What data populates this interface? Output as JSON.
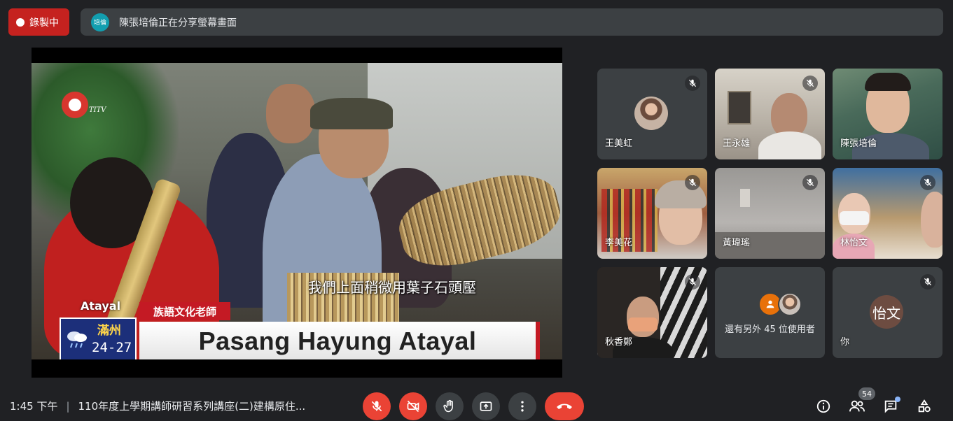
{
  "recording": {
    "label": "錄製中"
  },
  "share_banner": {
    "avatar_text": "培倫",
    "text": "陳張培倫正在分享螢幕畫面"
  },
  "presentation": {
    "subtitle": "我們上面稍微用葉子石頭壓",
    "tribe": "Atayal",
    "role": "族語文化老師",
    "name": "Pasang Hayung  Atayal",
    "weather_city": "滿州",
    "weather_temp": "24-27",
    "channel_logo": "TITV"
  },
  "participants": [
    {
      "name": "王美虹",
      "muted": true
    },
    {
      "name": "王永雄",
      "muted": true
    },
    {
      "name": "陳張培倫",
      "muted": false
    },
    {
      "name": "李美花",
      "muted": true
    },
    {
      "name": "黃瑋瑤",
      "muted": true
    },
    {
      "name": "林怡文",
      "muted": true
    },
    {
      "name": "秋香鄭",
      "muted": true
    },
    {
      "name": "你",
      "muted": true,
      "avatar_letter": "怡文"
    }
  ],
  "more_participants": {
    "text": "還有另外 45 位使用者"
  },
  "bottom_bar": {
    "time": "1:45 下午",
    "separator": "|",
    "meeting_title": "110年度上學期講師研習系列講座(二)建構原住...",
    "participant_count": "54"
  },
  "colors": {
    "accent_red": "#ea4335",
    "background": "#202124",
    "tile": "#3c4043"
  }
}
